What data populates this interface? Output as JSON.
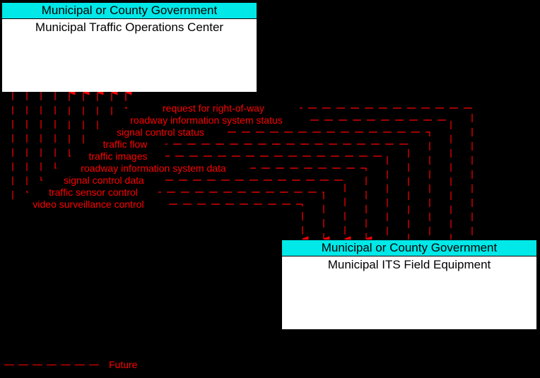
{
  "nodes": {
    "top": {
      "header": "Municipal or County Government",
      "body": "Municipal Traffic Operations Center"
    },
    "bottom": {
      "header": "Municipal or County Government",
      "body": "Municipal ITS Field Equipment"
    }
  },
  "flows": {
    "to_top": [
      "request for right-of-way",
      "roadway information system status",
      "signal control status",
      "traffic flow",
      "traffic images"
    ],
    "to_bottom": [
      "roadway information system data",
      "signal control data",
      "traffic sensor control",
      "video surveillance control"
    ]
  },
  "legend": {
    "label": "Future"
  },
  "colors": {
    "flow": "#ff0000",
    "node_header_bg": "#00e8e8"
  }
}
